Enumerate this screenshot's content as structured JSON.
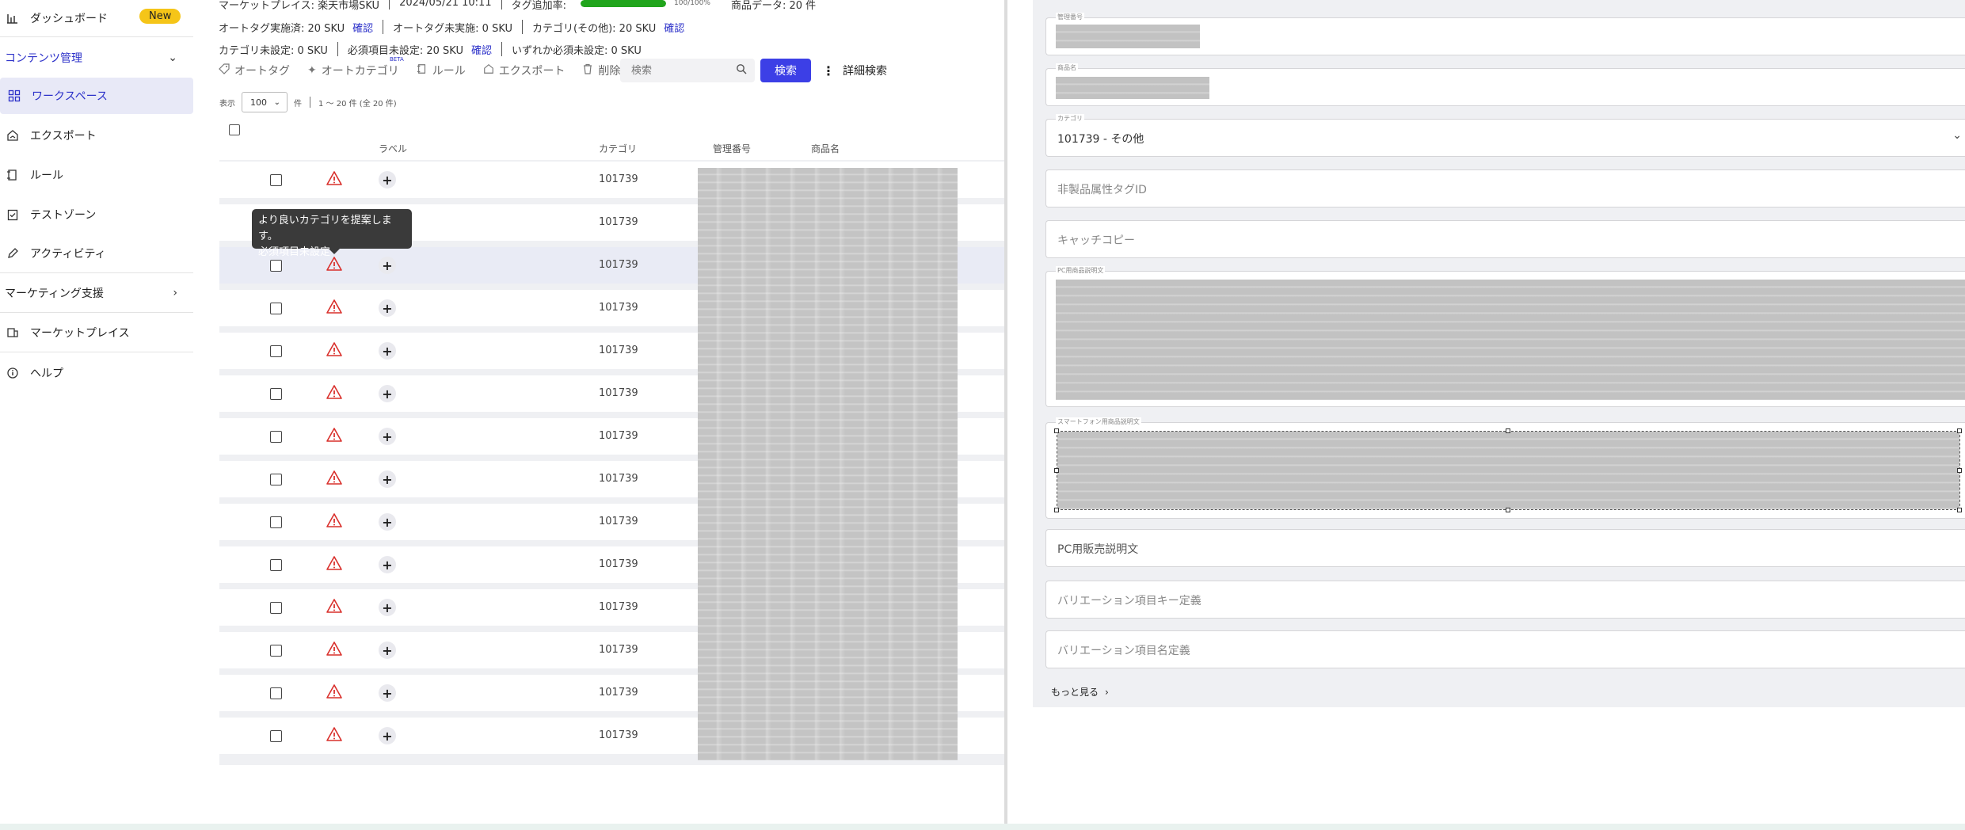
{
  "sidebar": {
    "dashboard": {
      "label": "ダッシュボード",
      "badge": "New"
    },
    "content_section": {
      "label": "コンテンツ管理"
    },
    "workspace": {
      "label": "ワークスペース"
    },
    "export": {
      "label": "エクスポート"
    },
    "rule": {
      "label": "ルール"
    },
    "testzone": {
      "label": "テストゾーン"
    },
    "activity": {
      "label": "アクティビティ"
    },
    "marketing_section": {
      "label": "マーケティング支援"
    },
    "marketplace": {
      "label": "マーケットプレイス"
    },
    "help": {
      "label": "ヘルプ"
    }
  },
  "summary": {
    "marketplace": "マーケットプレイス: 楽天市場SKU",
    "datetime": "2024/05/21 10:11",
    "tag_rate_label": "タグ追加率:",
    "tag_rate_value": 1.0,
    "tag_rate_text": "100/100%",
    "product_data": "商品データ: 20 件",
    "autotag_done": "オートタグ実施済: 20 SKU",
    "confirm": "確認",
    "autotag_not": "オートタグ未実施: 0 SKU",
    "category_other": "カテゴリ(その他): 20 SKU",
    "category_unset": "カテゴリ未設定: 0 SKU",
    "required_unset": "必須項目未設定: 20 SKU",
    "any_required_unset": "いずれか必須未設定: 0 SKU"
  },
  "toolbar": {
    "autotag": "オートタグ",
    "autocategory": "オートカテゴリ",
    "beta": "BETA",
    "rule": "ルール",
    "export": "エクスポート",
    "delete": "削除",
    "search_placeholder": "検索",
    "search_button": "検索",
    "advanced_search": "詳細検索"
  },
  "pager": {
    "display_label": "表示",
    "page_size": "100",
    "unit": "件",
    "range": "1 〜 20 件 (全 20 件)"
  },
  "table": {
    "headers": {
      "label": "ラベル",
      "category": "カテゴリ",
      "mgmt_no": "管理番号",
      "product_name": "商品名"
    },
    "rows": [
      {
        "category": "101739"
      },
      {
        "category": "101739"
      },
      {
        "category": "101739"
      },
      {
        "category": "101739"
      },
      {
        "category": "101739"
      },
      {
        "category": "101739"
      },
      {
        "category": "101739"
      },
      {
        "category": "101739"
      },
      {
        "category": "101739"
      },
      {
        "category": "101739"
      },
      {
        "category": "101739"
      },
      {
        "category": "101739"
      },
      {
        "category": "101739"
      },
      {
        "category": "101739"
      }
    ]
  },
  "tooltip": {
    "line1": "より良いカテゴリを提案します。",
    "line2": "必須項目未設定"
  },
  "detail": {
    "mgmt_no_label": "管理番号",
    "product_name_label": "商品名",
    "category_label": "カテゴリ",
    "category_value": "101739 - その他",
    "non_product_tag_placeholder": "非製品属性タグID",
    "catch_copy_placeholder": "キャッチコピー",
    "pc_desc_label": "PC用商品説明文",
    "sp_desc_label": "スマートフォン用商品説明文",
    "pc_sales_desc_placeholder": "PC用販売説明文",
    "variation_key_placeholder": "バリエーション項目キー定義",
    "variation_name_placeholder": "バリエーション項目名定義",
    "more": "もっと見る"
  },
  "colors": {
    "accent": "#3c3fe6",
    "progress": "#21a51c",
    "warning": "#d9302c",
    "badge": "#f5c518"
  }
}
